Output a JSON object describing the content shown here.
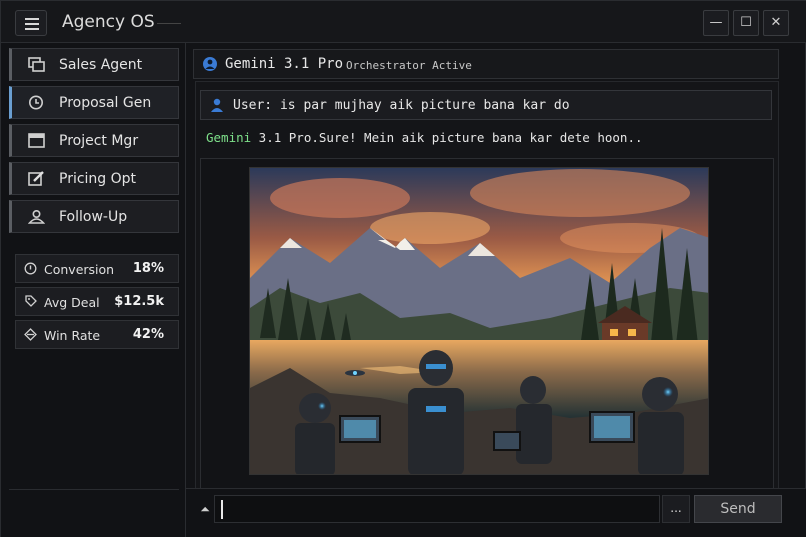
{
  "app": {
    "title": "Agency OS"
  },
  "window_controls": {
    "minimize": "—",
    "maximize": "☐",
    "close": "✕"
  },
  "sidebar": {
    "items": [
      {
        "label": "Sales Agent",
        "icon": "stacked-cards-icon",
        "active": false
      },
      {
        "label": "Proposal Gen",
        "icon": "clock-icon",
        "active": true
      },
      {
        "label": "Project Mgr",
        "icon": "window-icon",
        "active": false
      },
      {
        "label": "Pricing Opt",
        "icon": "edit-icon",
        "active": false
      },
      {
        "label": "Follow-Up",
        "icon": "contact-icon",
        "active": false
      }
    ],
    "stats": [
      {
        "label": "Conversion",
        "value": "18%",
        "icon": "info-circle-icon"
      },
      {
        "label": "Avg Deal",
        "value": "$12.5k",
        "icon": "tag-icon"
      },
      {
        "label": "Win Rate",
        "value": "42%",
        "icon": "target-icon"
      }
    ]
  },
  "header": {
    "model": "Gemini 3.1 Pro",
    "status": "Orchestrator Active"
  },
  "chat": {
    "user_message": "User: is par mujhay aik picture bana kar do",
    "reply_model": "Gemini",
    "reply_text": " 3.1 Pro.Sure! Mein aik picture bana kar dete hoon.."
  },
  "composer": {
    "attach": "⏶",
    "more": "...",
    "send_label": "Send"
  },
  "colors": {
    "accent": "#6a9ed0",
    "reply_green": "#7ee08a",
    "background": "#121316"
  }
}
